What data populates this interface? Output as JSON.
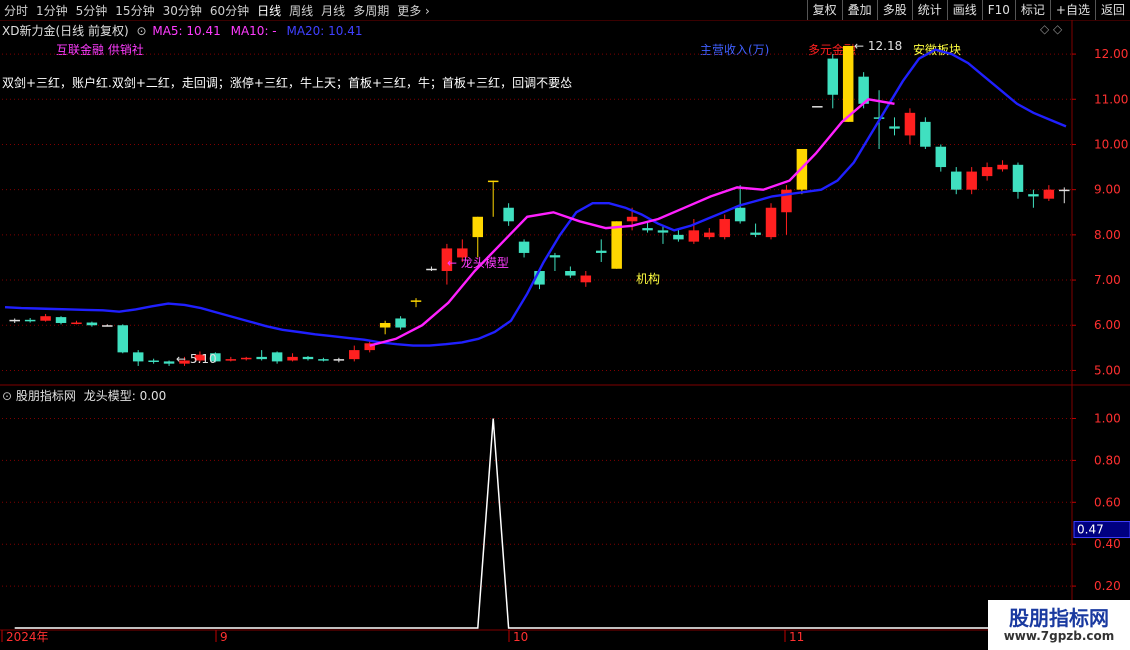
{
  "toolbar": {
    "periods": [
      "分时",
      "1分钟",
      "5分钟",
      "15分钟",
      "30分钟",
      "60分钟",
      "日线",
      "周线",
      "月线",
      "多周期",
      "更多"
    ],
    "active_period": "日线",
    "buttons": [
      "复权",
      "叠加",
      "多股",
      "统计",
      "画线",
      "F10",
      "标记",
      "+自选",
      "返回"
    ]
  },
  "main_header": {
    "title": "XD新力金(日线 前复权)",
    "ma5": "MA5: 10.41",
    "ma10": "MA10: -",
    "ma20": "MA20: 10.41",
    "colors": {
      "ma5": "#ff3cff",
      "ma10": "#ff3cff",
      "ma20": "#4040ff"
    }
  },
  "concept_tags": [
    "互联金融",
    "供销社"
  ],
  "right_tags": {
    "main_income": "主营收入(万)",
    "multi_finance": "多元金融",
    "anhui": "安徽板块"
  },
  "strategy_text": "双剑+三红，账户红.双剑+二红，走回调；涨停+三红，牛上天；首板+三红，牛；首板+三红，回调不要怂",
  "annotations": {
    "dragon": "龙头模型",
    "institution": "机构",
    "high_label": "12.18",
    "low_label": "5.10"
  },
  "sub_header": {
    "name": "股朋指标网",
    "indicator": "龙头模型: 0.00"
  },
  "price_axis": [
    "12.00",
    "11.00",
    "10.00",
    "9.00",
    "8.00",
    "7.00",
    "6.00",
    "5.00"
  ],
  "sub_axis": [
    "1.00",
    "0.80",
    "0.60",
    "0.40",
    "0.20"
  ],
  "sub_current": "0.47",
  "date_labels": [
    "2024年",
    "9",
    "10",
    "11"
  ],
  "watermark": {
    "line1": "股朋指标网",
    "line2": "www.7gpzb.com"
  },
  "colors": {
    "up": "#ff2020",
    "down": "#40e0c0",
    "limit": "#ffd700",
    "ma_line": "#2020ff",
    "trend_line": "#ff20ff",
    "grid": "#800000"
  },
  "chart_data": [
    {
      "type": "candlestick",
      "title": "XD新力金(日线 前复权)",
      "ylim": [
        4.7,
        12.4
      ],
      "candles": [
        {
          "o": 6.1,
          "c": 6.12,
          "h": 6.15,
          "l": 6.05,
          "t": "flat"
        },
        {
          "o": 6.12,
          "c": 6.1,
          "h": 6.16,
          "l": 6.06,
          "t": "down"
        },
        {
          "o": 6.1,
          "c": 6.2,
          "h": 6.25,
          "l": 6.08,
          "t": "up"
        },
        {
          "o": 6.18,
          "c": 6.05,
          "h": 6.2,
          "l": 6.02,
          "t": "down"
        },
        {
          "o": 6.05,
          "c": 6.06,
          "h": 6.1,
          "l": 6.02,
          "t": "up"
        },
        {
          "o": 6.06,
          "c": 6.0,
          "h": 6.08,
          "l": 5.97,
          "t": "down"
        },
        {
          "o": 6.0,
          "c": 6.0,
          "h": 6.02,
          "l": 5.98,
          "t": "flat"
        },
        {
          "o": 6.0,
          "c": 5.4,
          "h": 6.02,
          "l": 5.38,
          "t": "down"
        },
        {
          "o": 5.4,
          "c": 5.2,
          "h": 5.45,
          "l": 5.1,
          "t": "down"
        },
        {
          "o": 5.22,
          "c": 5.2,
          "h": 5.26,
          "l": 5.15,
          "t": "down"
        },
        {
          "o": 5.2,
          "c": 5.15,
          "h": 5.22,
          "l": 5.1,
          "t": "down"
        },
        {
          "o": 5.15,
          "c": 5.22,
          "h": 5.3,
          "l": 5.1,
          "t": "up"
        },
        {
          "o": 5.22,
          "c": 5.35,
          "h": 5.42,
          "l": 5.18,
          "t": "up"
        },
        {
          "o": 5.38,
          "c": 5.2,
          "h": 5.4,
          "l": 5.18,
          "t": "down"
        },
        {
          "o": 5.22,
          "c": 5.25,
          "h": 5.3,
          "l": 5.2,
          "t": "up"
        },
        {
          "o": 5.25,
          "c": 5.28,
          "h": 5.3,
          "l": 5.22,
          "t": "up"
        },
        {
          "o": 5.3,
          "c": 5.25,
          "h": 5.45,
          "l": 5.22,
          "t": "down"
        },
        {
          "o": 5.4,
          "c": 5.2,
          "h": 5.42,
          "l": 5.15,
          "t": "down"
        },
        {
          "o": 5.22,
          "c": 5.3,
          "h": 5.38,
          "l": 5.2,
          "t": "up"
        },
        {
          "o": 5.3,
          "c": 5.25,
          "h": 5.32,
          "l": 5.22,
          "t": "down"
        },
        {
          "o": 5.25,
          "c": 5.22,
          "h": 5.28,
          "l": 5.2,
          "t": "down"
        },
        {
          "o": 5.25,
          "c": 5.25,
          "h": 5.28,
          "l": 5.18,
          "t": "flat"
        },
        {
          "o": 5.25,
          "c": 5.45,
          "h": 5.55,
          "l": 5.2,
          "t": "up"
        },
        {
          "o": 5.45,
          "c": 5.6,
          "h": 5.65,
          "l": 5.4,
          "t": "up"
        },
        {
          "o": 5.95,
          "c": 6.05,
          "h": 6.1,
          "l": 5.8,
          "t": "limit"
        },
        {
          "o": 6.15,
          "c": 5.95,
          "h": 6.2,
          "l": 5.9,
          "t": "down"
        },
        {
          "o": 6.55,
          "c": 6.55,
          "h": 6.6,
          "l": 6.4,
          "t": "limit"
        },
        {
          "o": 7.25,
          "c": 7.25,
          "h": 7.3,
          "l": 7.2,
          "t": "flat"
        },
        {
          "o": 7.2,
          "c": 7.7,
          "h": 7.8,
          "l": 6.9,
          "t": "up"
        },
        {
          "o": 7.5,
          "c": 7.7,
          "h": 7.9,
          "l": 7.4,
          "t": "up"
        },
        {
          "o": 7.95,
          "c": 8.4,
          "h": 8.4,
          "l": 7.5,
          "t": "limit"
        },
        {
          "o": 9.2,
          "c": 9.2,
          "h": 9.2,
          "l": 8.4,
          "t": "limit"
        },
        {
          "o": 8.6,
          "c": 8.3,
          "h": 8.7,
          "l": 8.2,
          "t": "down"
        },
        {
          "o": 7.85,
          "c": 7.6,
          "h": 7.9,
          "l": 7.5,
          "t": "down"
        },
        {
          "o": 7.2,
          "c": 6.9,
          "h": 7.25,
          "l": 6.8,
          "t": "down"
        },
        {
          "o": 7.55,
          "c": 7.5,
          "h": 7.6,
          "l": 7.2,
          "t": "down"
        },
        {
          "o": 7.2,
          "c": 7.1,
          "h": 7.3,
          "l": 7.05,
          "t": "down"
        },
        {
          "o": 6.95,
          "c": 7.1,
          "h": 7.2,
          "l": 6.85,
          "t": "up"
        },
        {
          "o": 7.65,
          "c": 7.6,
          "h": 7.9,
          "l": 7.4,
          "t": "down"
        },
        {
          "o": 7.25,
          "c": 8.3,
          "h": 8.3,
          "l": 7.25,
          "t": "limit"
        },
        {
          "o": 8.3,
          "c": 8.4,
          "h": 8.6,
          "l": 8.1,
          "t": "up"
        },
        {
          "o": 8.1,
          "c": 8.15,
          "h": 8.3,
          "l": 8.05,
          "t": "down"
        },
        {
          "o": 8.1,
          "c": 8.05,
          "h": 8.2,
          "l": 7.8,
          "t": "down"
        },
        {
          "o": 8.0,
          "c": 7.9,
          "h": 8.15,
          "l": 7.85,
          "t": "down"
        },
        {
          "o": 7.85,
          "c": 8.1,
          "h": 8.35,
          "l": 7.8,
          "t": "up"
        },
        {
          "o": 7.95,
          "c": 8.05,
          "h": 8.15,
          "l": 7.9,
          "t": "up"
        },
        {
          "o": 7.95,
          "c": 8.35,
          "h": 8.45,
          "l": 7.9,
          "t": "up"
        },
        {
          "o": 8.3,
          "c": 8.6,
          "h": 9.1,
          "l": 8.25,
          "t": "down"
        },
        {
          "o": 8.05,
          "c": 8.0,
          "h": 8.25,
          "l": 7.95,
          "t": "down"
        },
        {
          "o": 7.95,
          "c": 8.6,
          "h": 8.7,
          "l": 7.9,
          "t": "up"
        },
        {
          "o": 8.5,
          "c": 9.0,
          "h": 9.1,
          "l": 8.0,
          "t": "up"
        },
        {
          "o": 9.0,
          "c": 9.9,
          "h": 9.9,
          "l": 8.9,
          "t": "limit"
        },
        {
          "o": 10.85,
          "c": 10.85,
          "h": 10.85,
          "l": 10.85,
          "t": "flat"
        },
        {
          "o": 11.9,
          "c": 11.1,
          "h": 12.0,
          "l": 10.8,
          "t": "down"
        },
        {
          "o": 10.5,
          "c": 12.18,
          "h": 12.18,
          "l": 10.5,
          "t": "limit"
        },
        {
          "o": 11.5,
          "c": 10.9,
          "h": 11.6,
          "l": 10.8,
          "t": "down"
        },
        {
          "o": 10.6,
          "c": 10.6,
          "h": 11.2,
          "l": 9.9,
          "t": "down"
        },
        {
          "o": 10.4,
          "c": 10.35,
          "h": 10.6,
          "l": 10.2,
          "t": "down"
        },
        {
          "o": 10.2,
          "c": 10.7,
          "h": 10.8,
          "l": 10.0,
          "t": "up"
        },
        {
          "o": 10.5,
          "c": 9.95,
          "h": 10.6,
          "l": 9.9,
          "t": "down"
        },
        {
          "o": 9.95,
          "c": 9.5,
          "h": 10.0,
          "l": 9.4,
          "t": "down"
        },
        {
          "o": 9.4,
          "c": 9.0,
          "h": 9.5,
          "l": 8.9,
          "t": "down"
        },
        {
          "o": 9.0,
          "c": 9.4,
          "h": 9.5,
          "l": 8.9,
          "t": "up"
        },
        {
          "o": 9.3,
          "c": 9.5,
          "h": 9.6,
          "l": 9.2,
          "t": "up"
        },
        {
          "o": 9.45,
          "c": 9.55,
          "h": 9.65,
          "l": 9.4,
          "t": "up"
        },
        {
          "o": 9.55,
          "c": 8.95,
          "h": 9.6,
          "l": 8.8,
          "t": "down"
        },
        {
          "o": 8.9,
          "c": 8.85,
          "h": 9.0,
          "l": 8.6,
          "t": "down"
        },
        {
          "o": 8.8,
          "c": 9.0,
          "h": 9.1,
          "l": 8.75,
          "t": "up"
        },
        {
          "o": 9.0,
          "c": 9.0,
          "h": 9.05,
          "l": 8.7,
          "t": "flat"
        }
      ],
      "ma20_line": [
        6.4,
        6.38,
        6.37,
        6.36,
        6.35,
        6.34,
        6.33,
        6.3,
        6.35,
        6.42,
        6.48,
        6.45,
        6.38,
        6.28,
        6.18,
        6.08,
        5.98,
        5.9,
        5.85,
        5.8,
        5.76,
        5.72,
        5.68,
        5.62,
        5.58,
        5.55,
        5.55,
        5.58,
        5.62,
        5.7,
        5.85,
        6.1,
        6.7,
        7.4,
        8.0,
        8.5,
        8.7,
        8.7,
        8.6,
        8.45,
        8.25,
        8.1,
        8.2,
        8.35,
        8.5,
        8.65,
        8.75,
        8.85,
        8.9,
        8.95,
        9.0,
        9.2,
        9.6,
        10.2,
        10.8,
        11.4,
        11.9,
        12.1,
        12.0,
        11.8,
        11.5,
        11.2,
        10.9,
        10.7,
        10.55,
        10.4
      ],
      "trend_line": [
        5.55,
        5.7,
        6.0,
        6.5,
        7.2,
        7.8,
        8.4,
        8.5,
        8.3,
        8.15,
        8.2,
        8.35,
        8.6,
        8.85,
        9.05,
        9.0,
        9.2,
        9.8,
        10.5,
        11.0,
        10.9
      ]
    },
    {
      "type": "line",
      "title": "股朋指标网 龙头模型",
      "ylim": [
        0,
        1.05
      ],
      "values": [
        0,
        0,
        0,
        0,
        0,
        0,
        0,
        0,
        0,
        0,
        0,
        0,
        0,
        0,
        0,
        0,
        0,
        0,
        0,
        0,
        0,
        0,
        0,
        0,
        0,
        0,
        0,
        0,
        0,
        0,
        0,
        1,
        0,
        0,
        0,
        0,
        0,
        0,
        0,
        0,
        0,
        0,
        0,
        0,
        0,
        0,
        0,
        0,
        0,
        0,
        0,
        0,
        0,
        0,
        0,
        0,
        0,
        0,
        0,
        0,
        0,
        0,
        0,
        0,
        0,
        0,
        0,
        0,
        0
      ]
    }
  ]
}
